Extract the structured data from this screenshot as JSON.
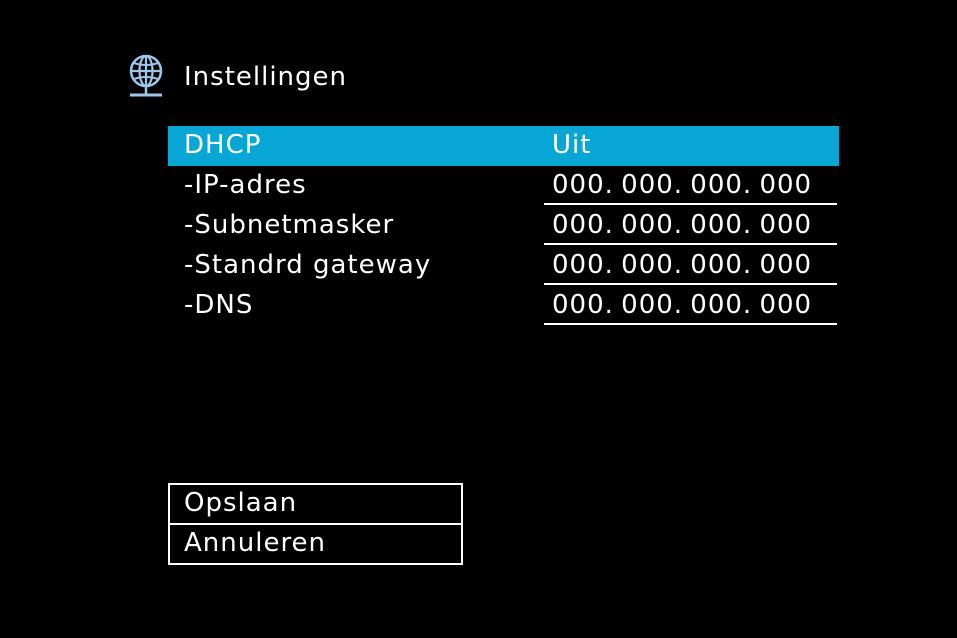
{
  "header": {
    "icon": "globe-network-icon",
    "title": "Instellingen"
  },
  "colors": {
    "background": "#000000",
    "selection": "#07a6d4",
    "text": "#ffffff",
    "icon": "#9fc6ea"
  },
  "settings": {
    "dhcp": {
      "label": "DHCP",
      "value": "Uit"
    },
    "ip_address": {
      "label": "-IP-adres",
      "value": "000. 000. 000. 000"
    },
    "subnet_mask": {
      "label": "-Subnetmasker",
      "value": "000. 000. 000. 000"
    },
    "default_gateway": {
      "label": "-Standrd gateway",
      "value": "000. 000. 000. 000"
    },
    "dns": {
      "label": "-DNS",
      "value": "000. 000. 000. 000"
    }
  },
  "actions": {
    "save_label": "Opslaan",
    "cancel_label": "Annuleren"
  }
}
